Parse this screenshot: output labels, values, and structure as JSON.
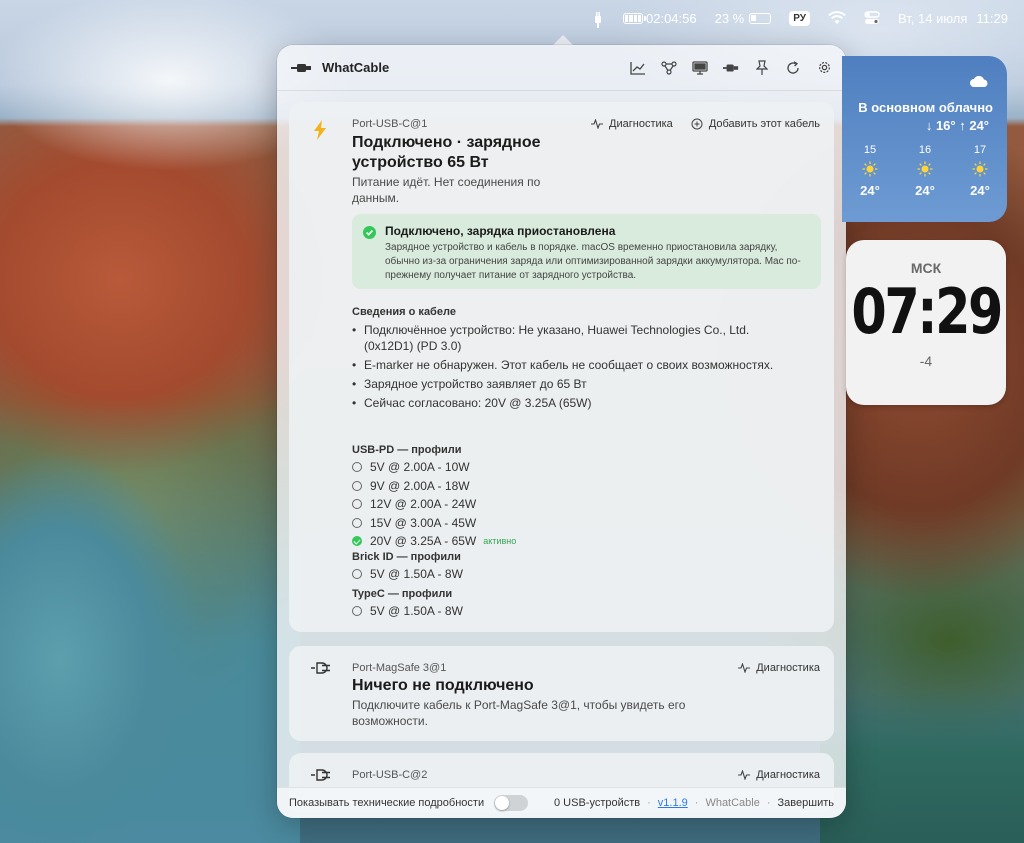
{
  "menubar": {
    "battery_time": "02:04:56",
    "battery_percent": "23 %",
    "input_language": "РУ",
    "date": "Вт, 14 июля",
    "time": "11:29"
  },
  "app": {
    "title": "WhatCable",
    "toolbar": [
      "chart-icon",
      "topology-icon",
      "display-icon",
      "cable-icon",
      "pin-icon",
      "refresh-icon",
      "settings-icon"
    ]
  },
  "ports": [
    {
      "name": "Port-USB-C@1",
      "icon": "bolt-icon",
      "actions": {
        "diagnostics": "Диагностика",
        "add_cable": "Добавить этот кабель"
      },
      "title": "Подключено · зарядное устройство 65 Вт",
      "subtitle": "Питание идёт. Нет соединения по данным.",
      "status": {
        "title": "Подключено, зарядка приостановлена",
        "text": "Зарядное устройство и кабель в порядке. macOS временно приостановила зарядку, обычно из-за ограничения заряда или оптимизированной зарядки аккумулятора. Mac по-прежнему получает питание от зарядного устройства."
      },
      "cable_info_title": "Сведения о кабеле",
      "cable_info": [
        "Подключённое устройство: Не указано, Huawei Technologies Co., Ltd. (0x12D1) (PD 3.0)",
        "E-marker не обнаружен. Этот кабель не сообщает о своих возможностях.",
        "Зарядное устройство заявляет до 65 Вт",
        "Сейчас согласовано: 20V @ 3.25A (65W)"
      ],
      "usbpd_title": "USB-PD — профили",
      "usbpd_profiles": [
        "5V @ 2.00A - 10W",
        "9V @ 2.00A - 18W",
        "12V @ 2.00A - 24W",
        "15V @ 3.00A - 45W",
        "20V @ 3.25A - 65W"
      ],
      "active_label": "активно",
      "brick_title": "Brick ID — профили",
      "brick_profiles": [
        "5V @ 1.50A - 8W"
      ],
      "typec_title": "TypeC — профили",
      "typec_profiles": [
        "5V @ 1.50A - 8W"
      ]
    },
    {
      "name": "Port-MagSafe 3@1",
      "icon": "plug-icon",
      "diagnostics": "Диагностика",
      "title": "Ничего не подключено",
      "subtitle": "Подключите кабель к Port-MagSafe 3@1, чтобы увидеть его возможности."
    },
    {
      "name": "Port-USB-C@2",
      "icon": "plug-icon",
      "diagnostics": "Диагностика"
    }
  ],
  "footer": {
    "toggle_label": "Показывать технические подробности",
    "usb_count": "0 USB-устройств",
    "dot": "·",
    "version": "v1.1.9",
    "app_name": "WhatCable",
    "quit": "Завершить"
  },
  "weather": {
    "condition": "В основном облачно",
    "range": "↓ 16° ↑ 24°",
    "hours": [
      {
        "hour": "15",
        "temp": "24°"
      },
      {
        "hour": "16",
        "temp": "24°"
      },
      {
        "hour": "17",
        "temp": "24°"
      }
    ]
  },
  "clock": {
    "city": "МСК",
    "time": "07:29",
    "offset": "-4"
  },
  "colors": {
    "accent": "#2d7be5",
    "success": "#34c759",
    "bolt": "#f2b21b"
  }
}
